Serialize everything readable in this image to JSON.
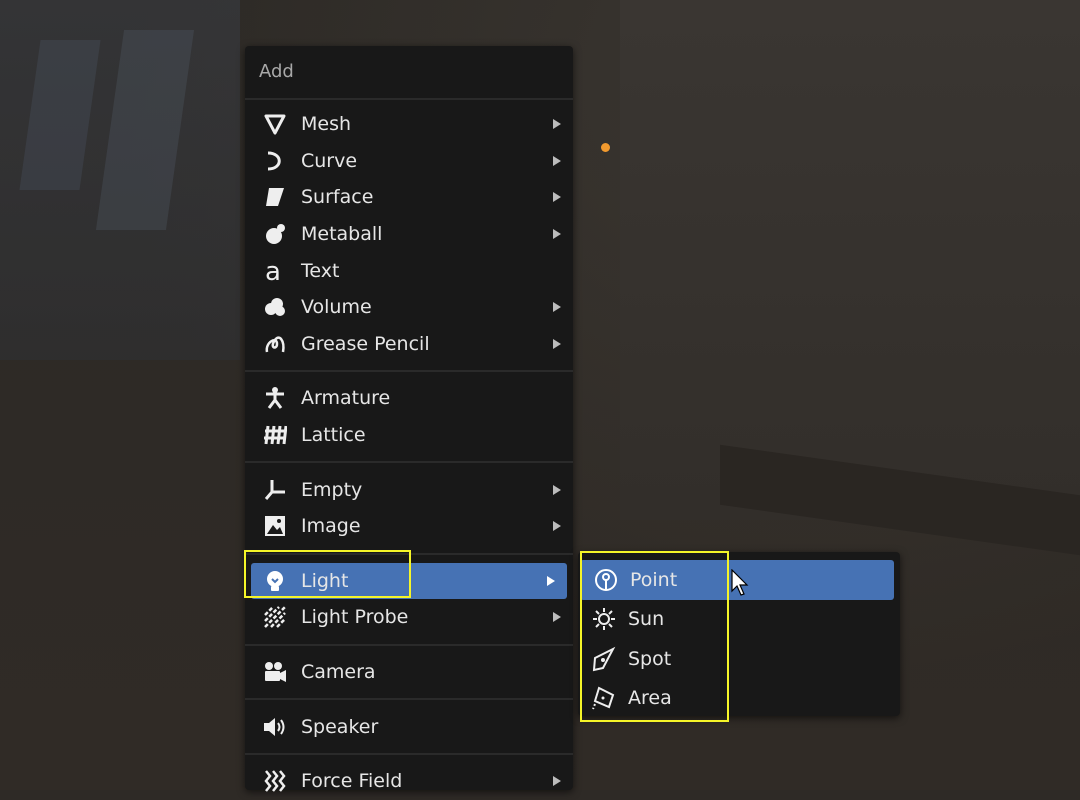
{
  "menu": {
    "title": "Add",
    "groups": [
      [
        {
          "label": "Mesh",
          "icon": "mesh-icon",
          "submenu": true
        },
        {
          "label": "Curve",
          "icon": "curve-icon",
          "submenu": true
        },
        {
          "label": "Surface",
          "icon": "surface-icon",
          "submenu": true
        },
        {
          "label": "Metaball",
          "icon": "metaball-icon",
          "submenu": true
        },
        {
          "label": "Text",
          "icon": "text-icon",
          "submenu": false
        },
        {
          "label": "Volume",
          "icon": "volume-icon",
          "submenu": true
        },
        {
          "label": "Grease Pencil",
          "icon": "grease-pencil-icon",
          "submenu": true
        }
      ],
      [
        {
          "label": "Armature",
          "icon": "armature-icon",
          "submenu": false
        },
        {
          "label": "Lattice",
          "icon": "lattice-icon",
          "submenu": false
        }
      ],
      [
        {
          "label": "Empty",
          "icon": "empty-icon",
          "submenu": true
        },
        {
          "label": "Image",
          "icon": "image-icon",
          "submenu": true
        }
      ],
      [
        {
          "label": "Light",
          "icon": "light-bulb-icon",
          "submenu": true,
          "active": true
        },
        {
          "label": "Light Probe",
          "icon": "light-probe-icon",
          "submenu": true
        }
      ],
      [
        {
          "label": "Camera",
          "icon": "camera-icon",
          "submenu": false
        }
      ],
      [
        {
          "label": "Speaker",
          "icon": "speaker-icon",
          "submenu": false
        }
      ],
      [
        {
          "label": "Force Field",
          "icon": "force-field-icon",
          "submenu": true
        }
      ]
    ]
  },
  "submenu": {
    "items": [
      {
        "label": "Point",
        "icon": "point-light-icon",
        "active": true
      },
      {
        "label": "Sun",
        "icon": "sun-light-icon"
      },
      {
        "label": "Spot",
        "icon": "spot-light-icon"
      },
      {
        "label": "Area",
        "icon": "area-light-icon"
      }
    ]
  },
  "colors": {
    "menu_bg": "#181818",
    "active_bg": "#4672b4",
    "highlight_box": "#f5f528",
    "light_origin": "#f29a2e"
  }
}
